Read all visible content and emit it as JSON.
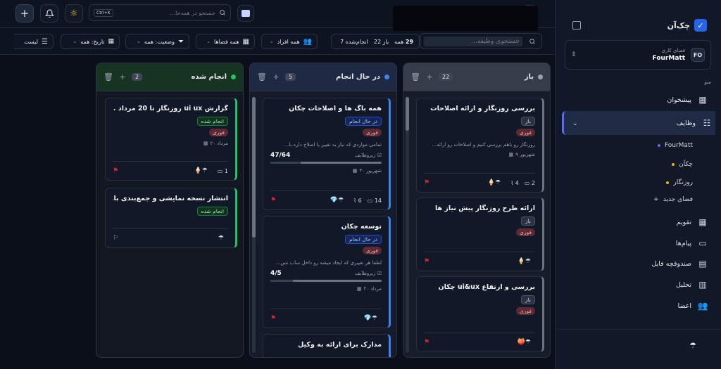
{
  "header": {
    "search_placeholder": "جستجو در همه‌جا...",
    "shortcut": "Ctrl+K",
    "task_search_placeholder": "جستجوی وظیفه..."
  },
  "filters": {
    "view_label": "لیست",
    "date_label": "تاریخ: همه",
    "status_label": "وضعیت: همه",
    "spaces_label": "همه فضاها",
    "people_label": "همه افراد"
  },
  "stats": {
    "total_prefix": "همه",
    "total": "29",
    "todo_label": "باز",
    "todo": "22",
    "done_label": "انجام‌شده",
    "done": "7"
  },
  "sidebar": {
    "brand": "چک‌آن",
    "workspace_label": "فضای کاری",
    "workspace_name": "FourMatt",
    "workspace_abbr": "FO",
    "menu_label": "منو",
    "items": [
      "پیشخوان",
      "وظایف",
      "تقویم",
      "پیام‌ها",
      "صندوقچه فایل",
      "تحلیل",
      "اعضا"
    ],
    "spaces": [
      {
        "name": "FourMatt",
        "color": "#6366f1"
      },
      {
        "name": "چکآن",
        "color": "#eab308"
      },
      {
        "name": "روزنگار",
        "color": "#eab308"
      }
    ],
    "new_space": "فضای جدید"
  },
  "columns": [
    {
      "title": "باز",
      "count": "22",
      "color": "#9ca3af",
      "accent": "#6b7280",
      "cards": [
        {
          "title": "بررسی روزنگار و ارائه اصلاحات",
          "status": "باز",
          "priority": "فوری",
          "desc": "روزنگار رو باهم بررسی کنیم و اصلاحات رو ارائه...",
          "date": "شهریور ۹",
          "comments": "2",
          "attachments": "4"
        },
        {
          "title": "ارائه طرح روزنگار پیش نیاز ها",
          "status": "باز",
          "priority": "فوری"
        },
        {
          "title": "بررسی و ارتفاع ui&ux چکآن",
          "status": "باز",
          "priority": "فوری"
        }
      ]
    },
    {
      "title": "در حال انجام",
      "count": "5",
      "color": "#3b82f6",
      "accent": "#3b82f6",
      "cards": [
        {
          "title": "همه باگ ها و اصلاحات چکآن",
          "status": "در حال انجام",
          "priority": "فوری",
          "desc": "تمامی مواردی که نیاز به تغییر یا اصلاح داره با...",
          "sub_label": "زیروظایف",
          "sub_count": "47/64",
          "sub_progress": 0.73,
          "date": "شهریور ۳۰",
          "comments": "14",
          "attachments": "6"
        },
        {
          "title": "توسعه چکآن",
          "status": "در حال انجام",
          "priority": "فوری",
          "desc": "لطفا هر تغییری که ایجاد میشه رو داخل ساب تس...",
          "sub_label": "زیروظایف",
          "sub_count": "4/5",
          "sub_progress": 0.8,
          "date": "مرداد ۲۰"
        },
        {
          "title": "مدارک برای ارائه به وکیل"
        }
      ]
    },
    {
      "title": "انجام شده",
      "count": "2",
      "color": "#22c55e",
      "accent": "#22c55e",
      "cards": [
        {
          "title": "گزارش ui ux روزنگار تا 20 مرداد ...",
          "status": "انجام شده",
          "priority": "فوری",
          "date": "مرداد ۲۰",
          "comments": "1"
        },
        {
          "title": "انتشار نسخه نمایشی و جمع‌بندی با...",
          "status": "انجام شده"
        }
      ]
    }
  ]
}
